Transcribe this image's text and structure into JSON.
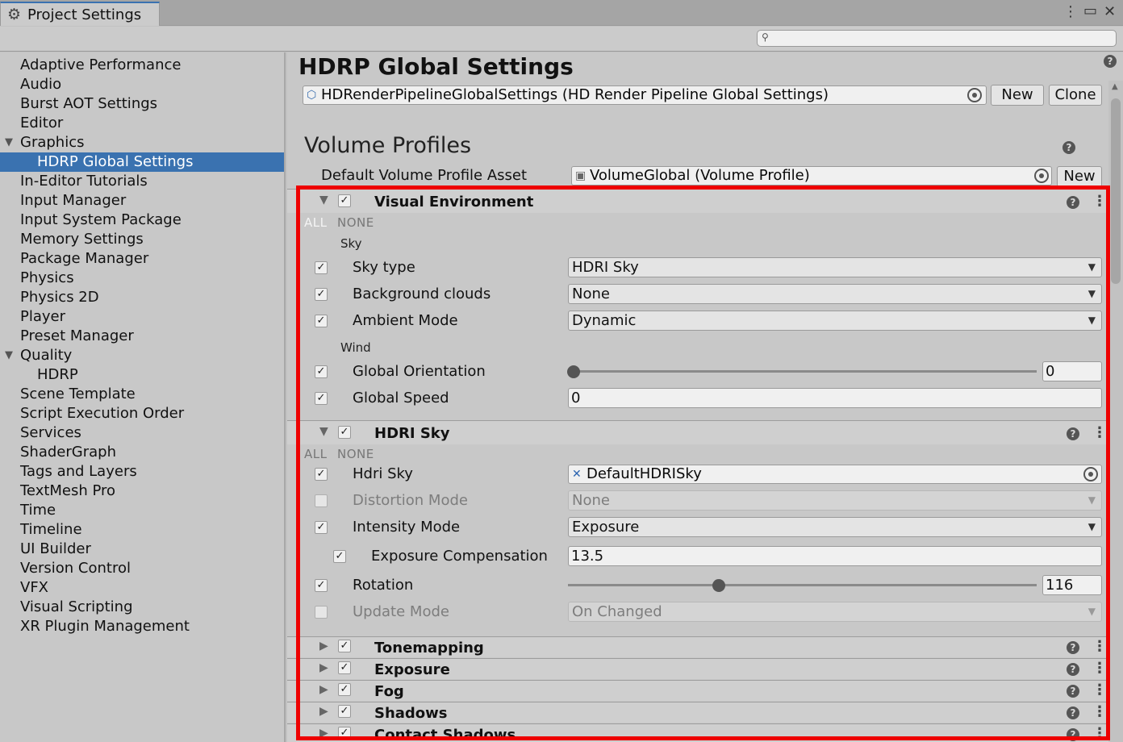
{
  "window": {
    "tab_title": "Project Settings",
    "menu_icon": "⋮",
    "maximize_icon": "▭",
    "close_icon": "✕"
  },
  "search": {
    "value": "",
    "icon": "search-icon"
  },
  "sidebar": {
    "items": [
      {
        "label": "Adaptive Performance"
      },
      {
        "label": "Audio"
      },
      {
        "label": "Burst AOT Settings"
      },
      {
        "label": "Editor"
      },
      {
        "label": "Graphics"
      },
      {
        "label": "HDRP Global Settings"
      },
      {
        "label": "In-Editor Tutorials"
      },
      {
        "label": "Input Manager"
      },
      {
        "label": "Input System Package"
      },
      {
        "label": "Memory Settings"
      },
      {
        "label": "Package Manager"
      },
      {
        "label": "Physics"
      },
      {
        "label": "Physics 2D"
      },
      {
        "label": "Player"
      },
      {
        "label": "Preset Manager"
      },
      {
        "label": "Quality"
      },
      {
        "label": "HDRP"
      },
      {
        "label": "Scene Template"
      },
      {
        "label": "Script Execution Order"
      },
      {
        "label": "Services"
      },
      {
        "label": "ShaderGraph"
      },
      {
        "label": "Tags and Layers"
      },
      {
        "label": "TextMesh Pro"
      },
      {
        "label": "Time"
      },
      {
        "label": "Timeline"
      },
      {
        "label": "UI Builder"
      },
      {
        "label": "Version Control"
      },
      {
        "label": "VFX"
      },
      {
        "label": "Visual Scripting"
      },
      {
        "label": "XR Plugin Management"
      }
    ],
    "selected": "HDRP Global Settings"
  },
  "main": {
    "title": "HDRP Global Settings",
    "asset_field": "HDRenderPipelineGlobalSettings (HD Render Pipeline Global Settings)",
    "new_label": "New",
    "clone_label": "Clone",
    "volume_profiles_heading": "Volume Profiles",
    "default_profile_label": "Default Volume Profile Asset",
    "default_profile_value": "VolumeGlobal (Volume Profile)",
    "default_profile_new": "New",
    "help_glyph": "?",
    "all_label": "ALL",
    "none_label": "NONE",
    "visual_environment": {
      "title": "Visual Environment",
      "enabled": true,
      "sky_group": "Sky",
      "sky_type_label": "Sky type",
      "sky_type_value": "HDRI Sky",
      "background_clouds_label": "Background clouds",
      "background_clouds_value": "None",
      "ambient_mode_label": "Ambient Mode",
      "ambient_mode_value": "Dynamic",
      "wind_group": "Wind",
      "global_orientation_label": "Global Orientation",
      "global_orientation_value": "0",
      "global_orientation_fraction": 0,
      "global_speed_label": "Global Speed",
      "global_speed_value": "0"
    },
    "hdri_sky": {
      "title": "HDRI Sky",
      "enabled": true,
      "hdri_sky_label": "Hdri Sky",
      "hdri_sky_value": "DefaultHDRISky",
      "distortion_mode_label": "Distortion Mode",
      "distortion_mode_value": "None",
      "intensity_mode_label": "Intensity Mode",
      "intensity_mode_value": "Exposure",
      "exposure_comp_label": "Exposure Compensation",
      "exposure_comp_value": "13.5",
      "rotation_label": "Rotation",
      "rotation_value": "116",
      "rotation_fraction": 0.322,
      "update_mode_label": "Update Mode",
      "update_mode_value": "On Changed"
    },
    "collapsed_sections": [
      {
        "title": "Tonemapping"
      },
      {
        "title": "Exposure"
      },
      {
        "title": "Fog"
      },
      {
        "title": "Shadows"
      },
      {
        "title": "Contact Shadows"
      }
    ]
  },
  "colors": {
    "selection": "#3a72b0",
    "highlight_box": "#ee0000",
    "panel_bg": "#c8c8c8"
  }
}
